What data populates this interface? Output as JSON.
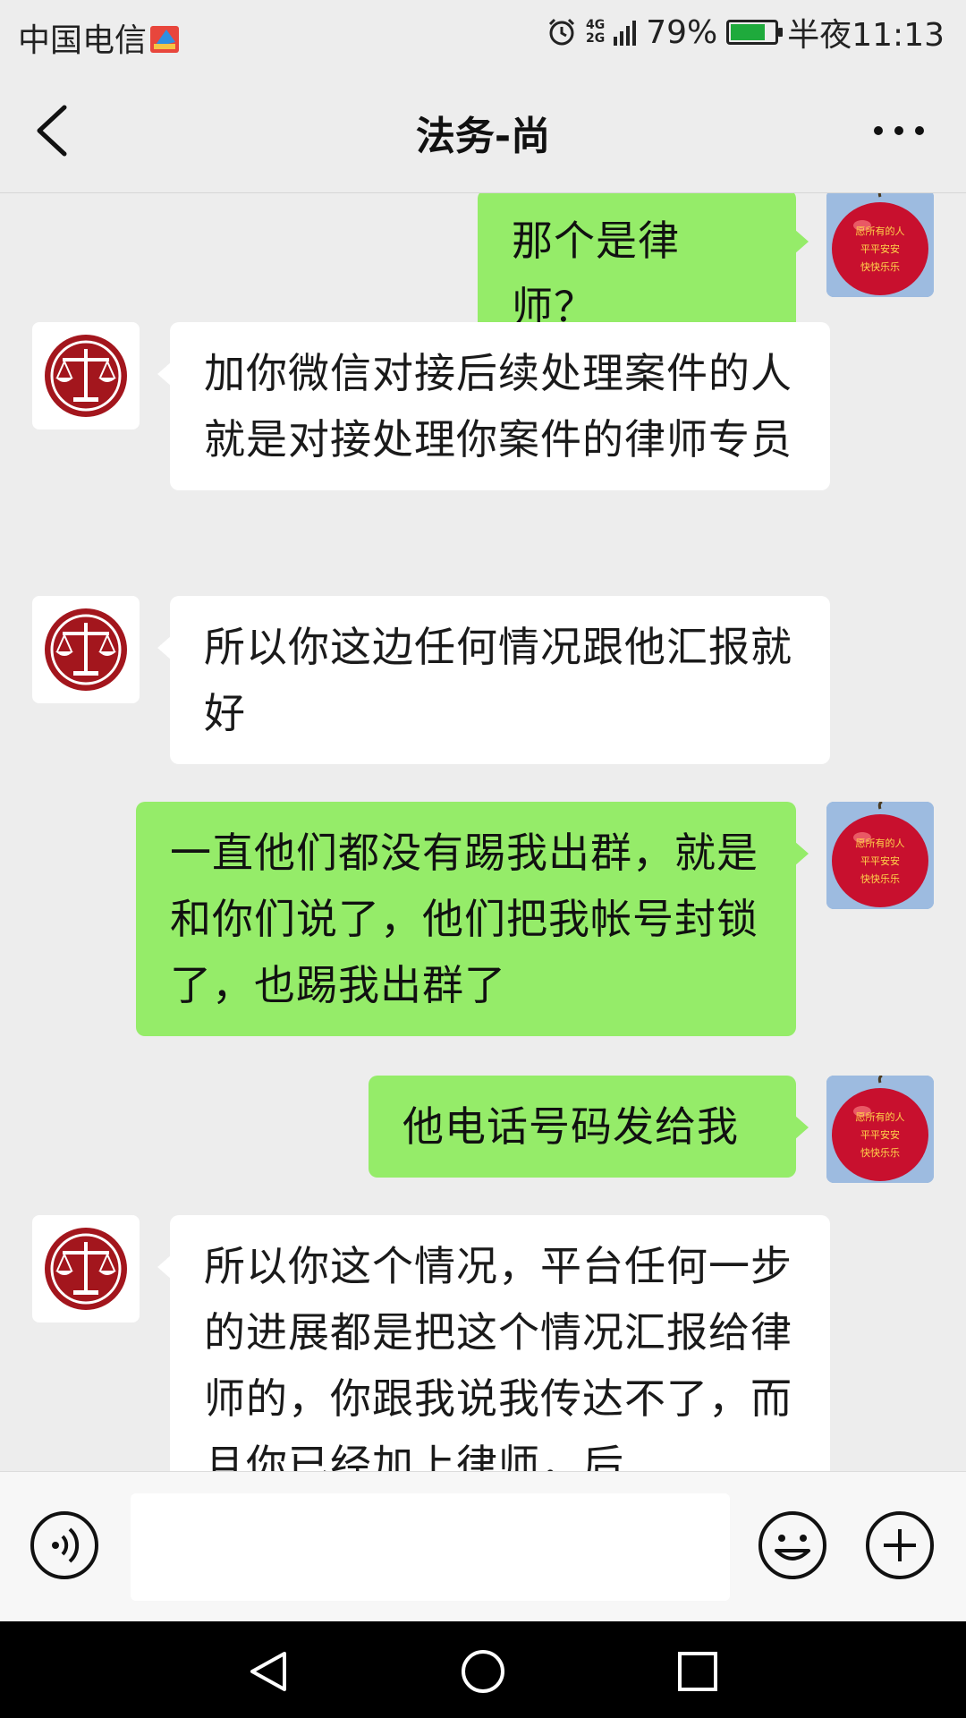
{
  "status_bar": {
    "carrier": "中国电信",
    "network": [
      "4G",
      "2G"
    ],
    "battery": "79%",
    "battery_level": 0.79,
    "time": "半夜11:13"
  },
  "header": {
    "title": "法务-尚"
  },
  "messages": [
    {
      "side": "right",
      "text": "那个是律师？",
      "avatar": "apple-avatar"
    },
    {
      "side": "left",
      "text": "加你微信对接后续处理案件的人就是对接处理你案件的律师专员",
      "avatar": "scales-avatar"
    },
    {
      "side": "left",
      "text": "所以你这边任何情况跟他汇报就好",
      "avatar": "scales-avatar"
    },
    {
      "side": "right",
      "text": "一直他们都没有踢我出群，就是和你们说了，他们把我帐号封锁了，也踢我出群了",
      "avatar": "apple-avatar"
    },
    {
      "side": "right",
      "text": "他电话号码发给我",
      "avatar": "apple-avatar"
    },
    {
      "side": "left",
      "text": "所以你这个情况，平台任何一步的进展都是把这个情况汇报给律师的，你跟我说我传达不了，而且你已经加上律师，后",
      "avatar": "scales-avatar"
    }
  ],
  "apple_avatar_text": [
    "愿所有的人",
    "平平安安",
    "快快乐乐"
  ],
  "input_bar": {
    "value": "",
    "placeholder": ""
  },
  "colors": {
    "sent_bubble": "#95ec69",
    "received_bubble": "#ffffff",
    "background": "#ededed",
    "scales_red": "#a3161d",
    "apple_red": "#c8102e"
  }
}
